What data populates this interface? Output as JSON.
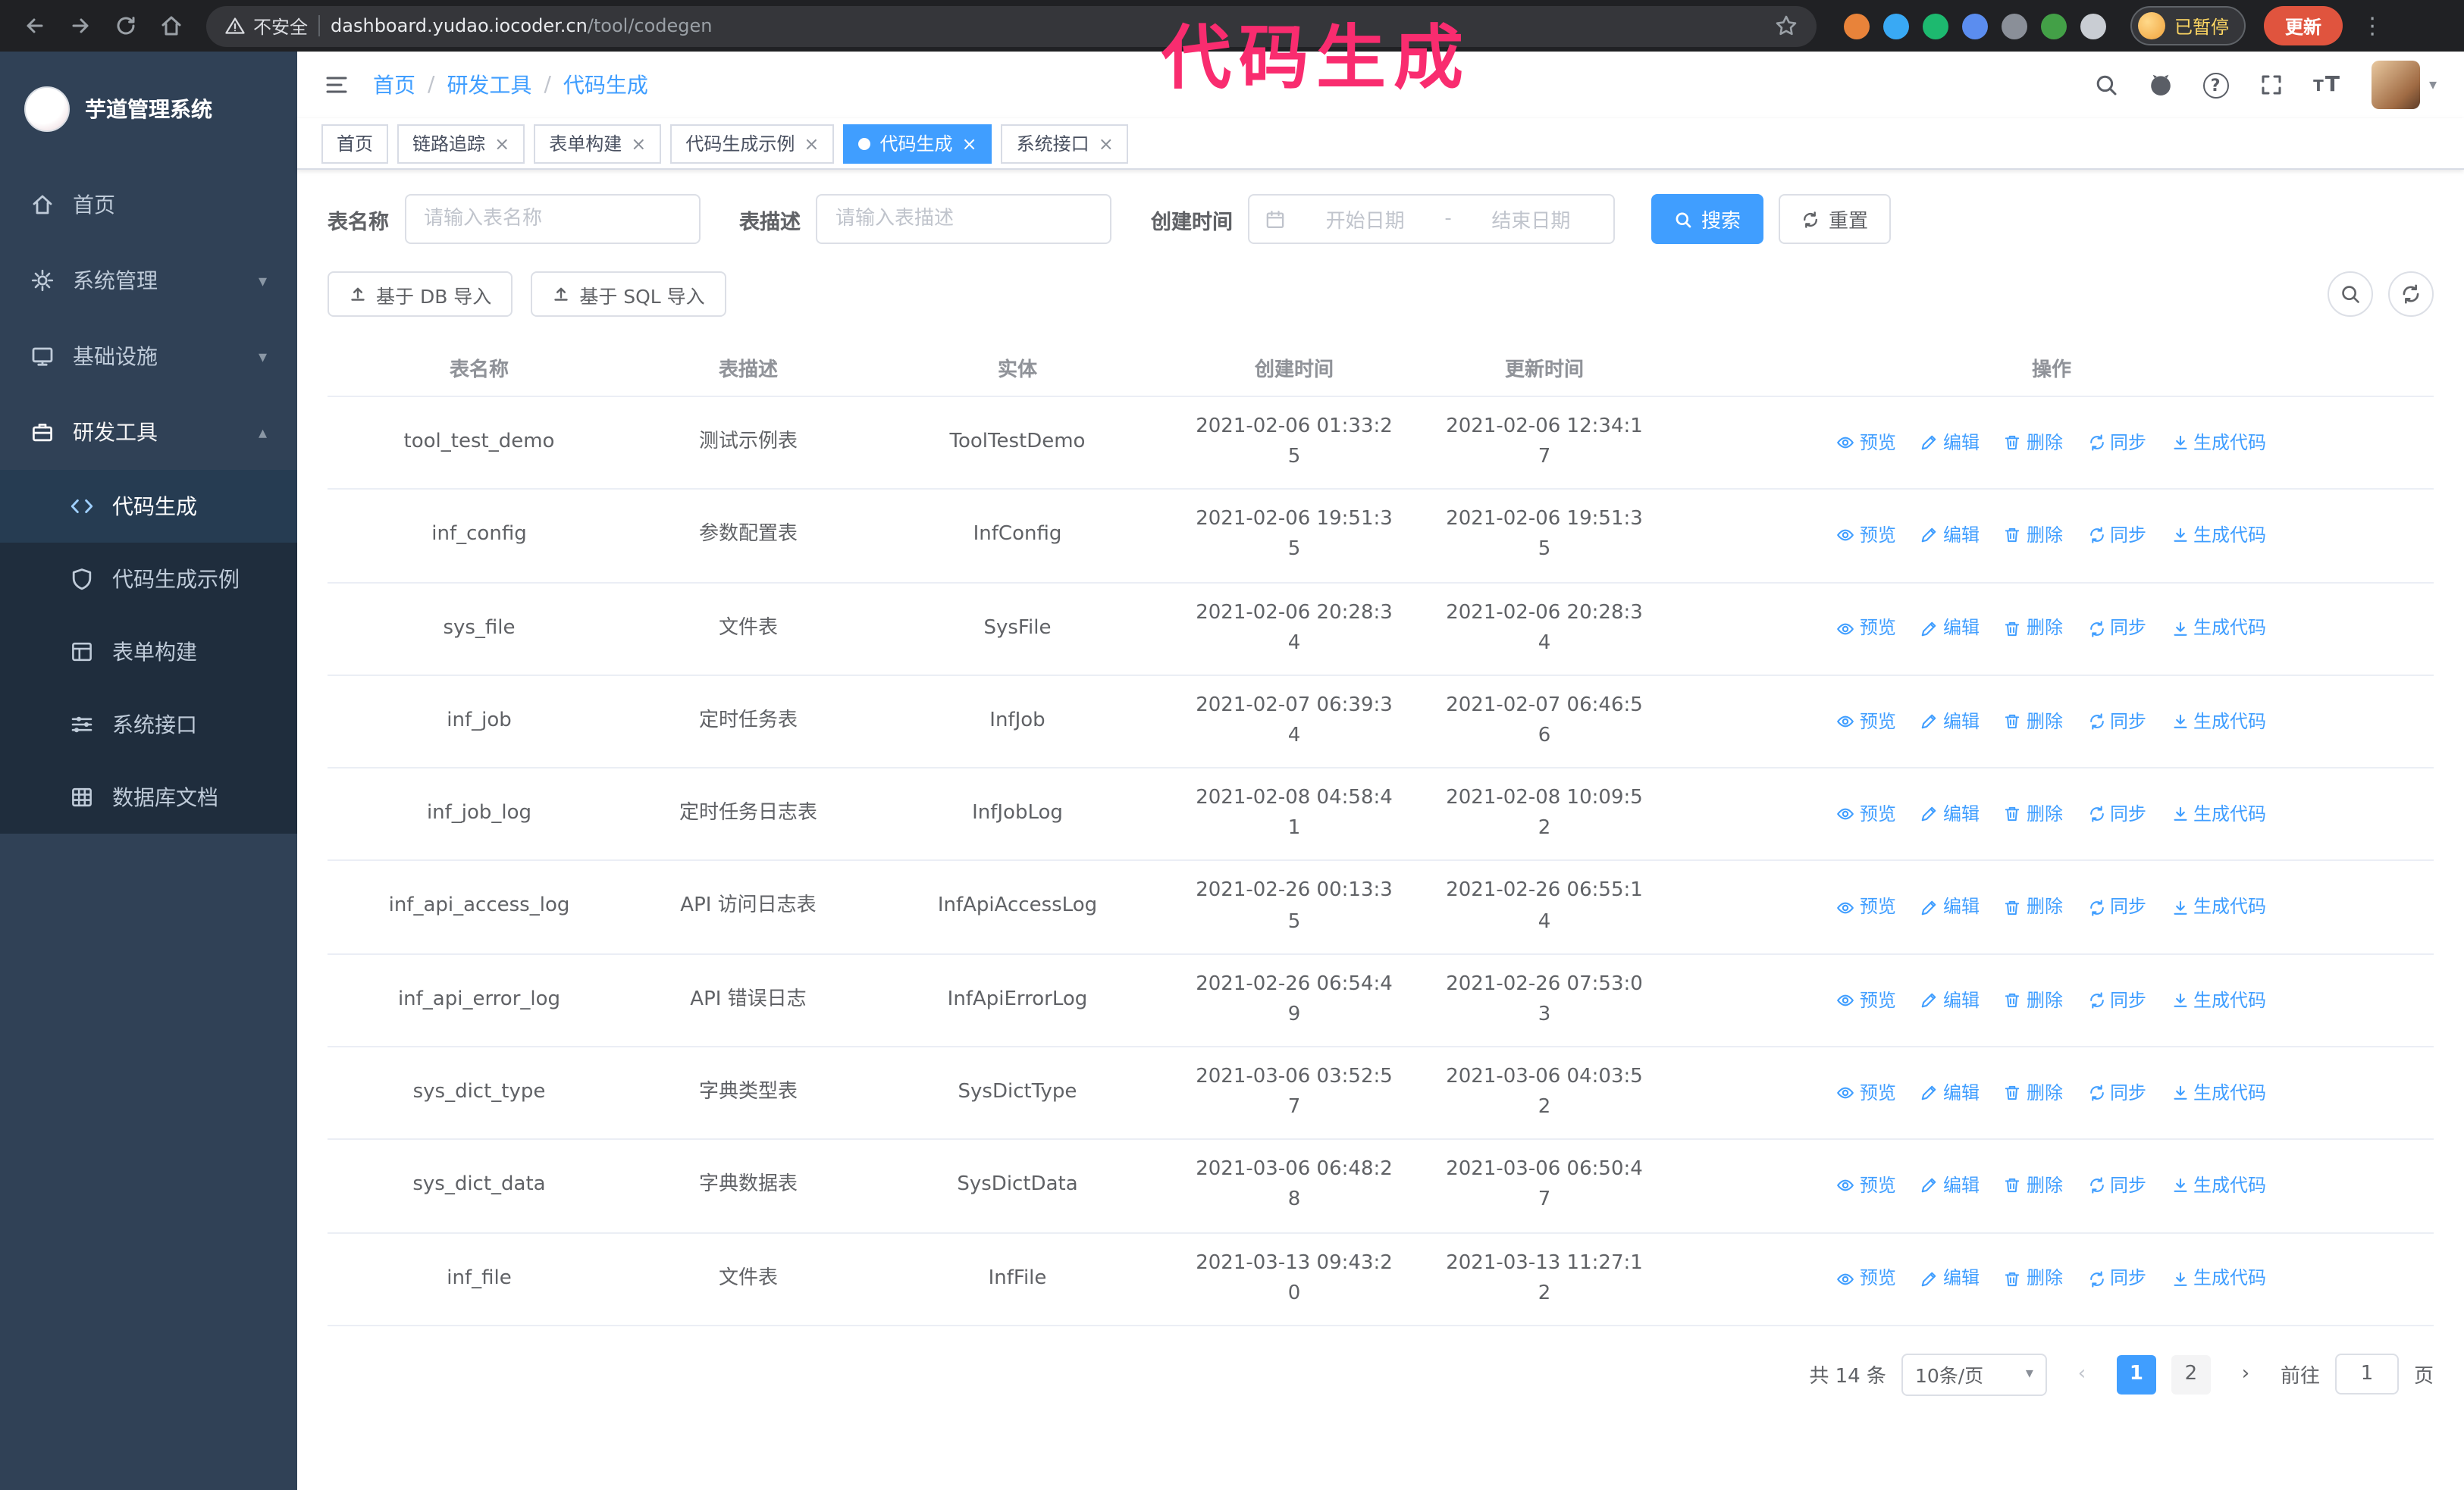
{
  "theme": {
    "accent": "#409eff",
    "annotation": "#f92c6f",
    "chrome-bg": "#202124",
    "omnibox-bg": "#35363a",
    "sidebar-bg": "#304156",
    "submenu-bg": "#1f2d3d",
    "sidebar-text": "#bfcbd9",
    "active-bg": "#263c52",
    "update-bg": "#e0543e"
  },
  "browser": {
    "security_label": "不安全",
    "url_host": "dashboard.yudao.iocoder.cn",
    "url_path": "/tool/codegen",
    "paused_badge": "已暂停",
    "update_button": "更新"
  },
  "overlay": {
    "text": "代码生成"
  },
  "sidebar": {
    "logo_title": "芋道管理系统",
    "items": [
      {
        "label": "首页"
      },
      {
        "label": "系统管理"
      },
      {
        "label": "基础设施"
      },
      {
        "label": "研发工具"
      }
    ],
    "sub_items": [
      {
        "label": "代码生成"
      },
      {
        "label": "代码生成示例"
      },
      {
        "label": "表单构建"
      },
      {
        "label": "系统接口"
      },
      {
        "label": "数据库文档"
      }
    ]
  },
  "header": {
    "breadcrumb": [
      "首页",
      "研发工具",
      "代码生成"
    ]
  },
  "tabs": [
    {
      "label": "首页"
    },
    {
      "label": "链路追踪"
    },
    {
      "label": "表单构建"
    },
    {
      "label": "代码生成示例"
    },
    {
      "label": "代码生成"
    },
    {
      "label": "系统接口"
    }
  ],
  "filters": {
    "table_name_label": "表名称",
    "table_name_placeholder": "请输入表名称",
    "table_desc_label": "表描述",
    "table_desc_placeholder": "请输入表描述",
    "create_time_label": "创建时间",
    "date_start_placeholder": "开始日期",
    "date_end_placeholder": "结束日期",
    "search_button": "搜索",
    "reset_button": "重置"
  },
  "toolbar": {
    "import_db": "基于 DB 导入",
    "import_sql": "基于 SQL 导入"
  },
  "table": {
    "columns": [
      "表名称",
      "表描述",
      "实体",
      "创建时间",
      "更新时间",
      "操作"
    ],
    "actions": [
      "预览",
      "编辑",
      "删除",
      "同步",
      "生成代码"
    ],
    "rows": [
      {
        "name": "tool_test_demo",
        "desc": "测试示例表",
        "entity": "ToolTestDemo",
        "created": "2021-02-06 01:33:25",
        "updated": "2021-02-06 12:34:17"
      },
      {
        "name": "inf_config",
        "desc": "参数配置表",
        "entity": "InfConfig",
        "created": "2021-02-06 19:51:35",
        "updated": "2021-02-06 19:51:35"
      },
      {
        "name": "sys_file",
        "desc": "文件表",
        "entity": "SysFile",
        "created": "2021-02-06 20:28:34",
        "updated": "2021-02-06 20:28:34"
      },
      {
        "name": "inf_job",
        "desc": "定时任务表",
        "entity": "InfJob",
        "created": "2021-02-07 06:39:34",
        "updated": "2021-02-07 06:46:56"
      },
      {
        "name": "inf_job_log",
        "desc": "定时任务日志表",
        "entity": "InfJobLog",
        "created": "2021-02-08 04:58:41",
        "updated": "2021-02-08 10:09:52"
      },
      {
        "name": "inf_api_access_log",
        "desc": "API 访问日志表",
        "entity": "InfApiAccessLog",
        "created": "2021-02-26 00:13:35",
        "updated": "2021-02-26 06:55:14"
      },
      {
        "name": "inf_api_error_log",
        "desc": "API 错误日志",
        "entity": "InfApiErrorLog",
        "created": "2021-02-26 06:54:49",
        "updated": "2021-02-26 07:53:03"
      },
      {
        "name": "sys_dict_type",
        "desc": "字典类型表",
        "entity": "SysDictType",
        "created": "2021-03-06 03:52:57",
        "updated": "2021-03-06 04:03:52"
      },
      {
        "name": "sys_dict_data",
        "desc": "字典数据表",
        "entity": "SysDictData",
        "created": "2021-03-06 06:48:28",
        "updated": "2021-03-06 06:50:47"
      },
      {
        "name": "inf_file",
        "desc": "文件表",
        "entity": "InfFile",
        "created": "2021-03-13 09:43:20",
        "updated": "2021-03-13 11:27:12"
      }
    ]
  },
  "pagination": {
    "total": "共 14 条",
    "page_size": "10条/页",
    "page_1": "1",
    "page_2": "2",
    "goto_label": "前往",
    "goto_value": "1",
    "goto_suffix": "页"
  },
  "icons": {
    "slash": "/",
    "close": "×",
    "chevron-down": "▾",
    "chevron-up": "▴",
    "caret-down": "▾",
    "kebab": "⋮",
    "prev": "‹",
    "next": "›",
    "range-separator": "-",
    "question": "?",
    "font-size-large": "T",
    "font-size-small": "T"
  }
}
